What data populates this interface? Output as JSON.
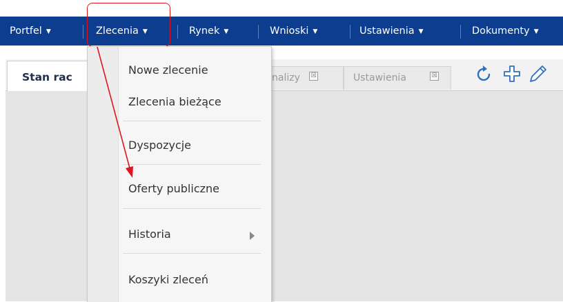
{
  "nav": {
    "items": [
      {
        "label": "Portfel"
      },
      {
        "label": "Zlecenia"
      },
      {
        "label": "Rynek"
      },
      {
        "label": "Wnioski"
      },
      {
        "label": "Ustawienia"
      },
      {
        "label": "Dokumenty"
      }
    ],
    "caret": "▼",
    "active_item": "Zlecenia"
  },
  "tabs": {
    "main": "Stan rac",
    "inactive": [
      {
        "label": "nalizy",
        "close": "☒"
      },
      {
        "label": "Ustawienia",
        "close": "☒"
      }
    ]
  },
  "toolbar": {
    "icons": [
      "refresh-icon",
      "add-cross-icon",
      "pencil-icon"
    ],
    "icon_color": "#2f6fb5"
  },
  "dropdown": {
    "items": [
      "Nowe zlecenie",
      "Zlecenia bieżące",
      "Dyspozycje",
      "Oferty publiczne",
      "Historia",
      "Koszyki zleceń"
    ],
    "submenu_item": "Historia"
  },
  "colors": {
    "navbar": "#0d3d8e",
    "annotation": "#e0141e",
    "content_bg": "#e4e4e4"
  }
}
